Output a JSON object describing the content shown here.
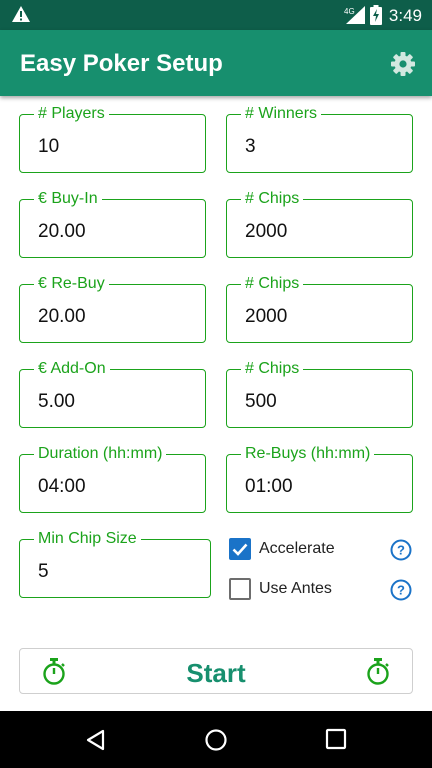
{
  "status": {
    "network": "4G",
    "time": "3:49"
  },
  "appbar": {
    "title": "Easy Poker Setup",
    "settings_icon": "gear-icon"
  },
  "fields": {
    "players": {
      "label": "# Players",
      "value": "10"
    },
    "winners": {
      "label": "# Winners",
      "value": "3"
    },
    "buyin": {
      "label": "€ Buy-In",
      "value": "20.00"
    },
    "buyin_chips": {
      "label": "# Chips",
      "value": "2000"
    },
    "rebuy": {
      "label": "€ Re-Buy",
      "value": "20.00"
    },
    "rebuy_chips": {
      "label": "# Chips",
      "value": "2000"
    },
    "addon": {
      "label": "€ Add-On",
      "value": "5.00"
    },
    "addon_chips": {
      "label": "# Chips",
      "value": "500"
    },
    "duration": {
      "label": "Duration (hh:mm)",
      "value": "04:00"
    },
    "rebuys": {
      "label": "Re-Buys (hh:mm)",
      "value": "01:00"
    },
    "minchip": {
      "label": "Min Chip Size",
      "value": "5"
    }
  },
  "options": {
    "accelerate": {
      "label": "Accelerate",
      "checked": true
    },
    "antes": {
      "label": "Use Antes",
      "checked": false
    }
  },
  "start_button": {
    "label": "Start"
  },
  "colors": {
    "statusbar": "#0e5e4a",
    "appbar": "#178f6e",
    "field_accent": "#1ba31b",
    "checkbox": "#1a73c8"
  }
}
